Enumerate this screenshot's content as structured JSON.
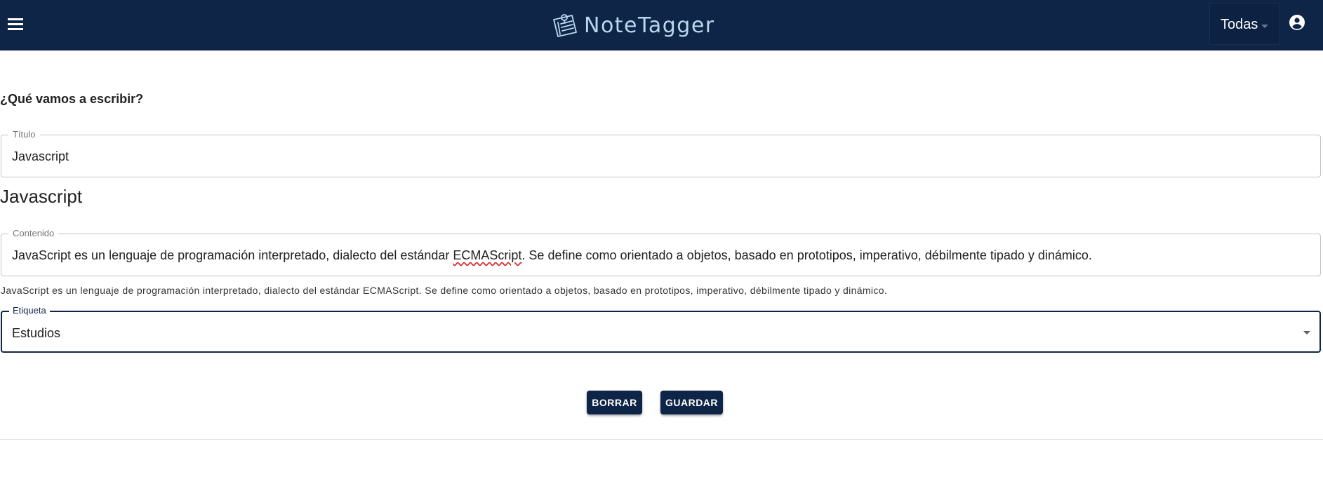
{
  "header": {
    "app_name": "NoteTagger",
    "logo_icon": "notepad-pin-icon",
    "filter_value": "Todas",
    "menu_icon": "hamburger-menu-icon",
    "account_icon": "account-circle-icon",
    "colors": {
      "bar": "#0f2548",
      "brand_text": "#b9d8ee"
    }
  },
  "form": {
    "prompt": "¿Qué vamos a escribir?",
    "title_label": "Título",
    "title_value": "Javascript",
    "content_label": "Contenido",
    "content_value_start": "JavaScript es un lenguaje de programación interpretado, dialecto del estándar ",
    "content_value_flagged": "ECMAScript",
    "content_value_end": ". Se define como orientado a objetos,  basado en prototipos, imperativo, débilmente tipado y dinámico.",
    "tag_label": "Etiqueta",
    "tag_value": "Estudios"
  },
  "preview": {
    "title": "Javascript",
    "content": "JavaScript es un lenguaje de programación interpretado, dialecto del estándar ECMAScript. Se define como orientado a objetos,  basado en prototipos, imperativo, débilmente tipado y dinámico."
  },
  "actions": {
    "delete_label": "BORRAR",
    "save_label": "GUARDAR"
  }
}
